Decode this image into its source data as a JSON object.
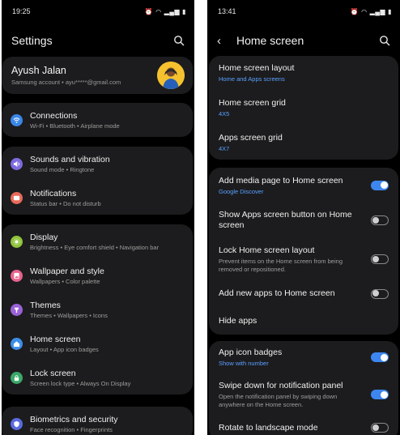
{
  "left": {
    "status": {
      "time": "19:25"
    },
    "header": {
      "title": "Settings"
    },
    "profile": {
      "name": "Ayush Jalan",
      "subtitle": "Samsung account  •  ayu*****@gmail.com"
    },
    "groups": [
      [
        {
          "title": "Connections",
          "sub": "Wi-Fi  •  Bluetooth  •  Airplane mode",
          "icon": "wifi-icon",
          "color": "#3a86e8"
        }
      ],
      [
        {
          "title": "Sounds and vibration",
          "sub": "Sound mode  •  Ringtone",
          "icon": "speaker-icon",
          "color": "#7d6be0"
        },
        {
          "title": "Notifications",
          "sub": "Status bar  •  Do not disturb",
          "icon": "notification-icon",
          "color": "#e86a5a"
        }
      ],
      [
        {
          "title": "Display",
          "sub": "Brightness  •  Eye comfort shield  •  Navigation bar",
          "icon": "brightness-icon",
          "color": "#8fc43a"
        },
        {
          "title": "Wallpaper and style",
          "sub": "Wallpapers  •  Color palette",
          "icon": "wallpaper-icon",
          "color": "#e8638c"
        },
        {
          "title": "Themes",
          "sub": "Themes  •  Wallpapers  •  Icons",
          "icon": "themes-icon",
          "color": "#9a62d6"
        },
        {
          "title": "Home screen",
          "sub": "Layout  •  App icon badges",
          "icon": "home-icon",
          "color": "#3d8ee8"
        },
        {
          "title": "Lock screen",
          "sub": "Screen lock type  •  Always On Display",
          "icon": "lock-icon",
          "color": "#3aa869"
        }
      ],
      [
        {
          "title": "Biometrics and security",
          "sub": "Face recognition  •  Fingerprints",
          "icon": "shield-icon",
          "color": "#5a6be0"
        }
      ]
    ]
  },
  "right": {
    "status": {
      "time": "13:41"
    },
    "header": {
      "title": "Home screen"
    },
    "groups": [
      [
        {
          "title": "Home screen layout",
          "sub": "Home and Apps screens"
        },
        {
          "title": "Home screen grid",
          "sub": "4X5"
        },
        {
          "title": "Apps screen grid",
          "sub": "4X7"
        }
      ],
      [
        {
          "title": "Add media page to Home screen",
          "sub": "Google Discover",
          "toggle": true
        },
        {
          "title": "Show Apps screen button on Home screen",
          "toggle": false
        },
        {
          "title": "Lock Home screen layout",
          "desc": "Prevent items on the Home screen from being removed or repositioned.",
          "toggle": false
        },
        {
          "title": "Add new apps to Home screen",
          "toggle": false
        },
        {
          "title": "Hide apps"
        }
      ],
      [
        {
          "title": "App icon badges",
          "sub": "Show with number",
          "toggle": true
        },
        {
          "title": "Swipe down for notification panel",
          "desc": "Open the notification panel by swiping down anywhere on the Home screen.",
          "toggle": true
        },
        {
          "title": "Rotate to landscape mode",
          "toggle": false
        }
      ]
    ]
  }
}
